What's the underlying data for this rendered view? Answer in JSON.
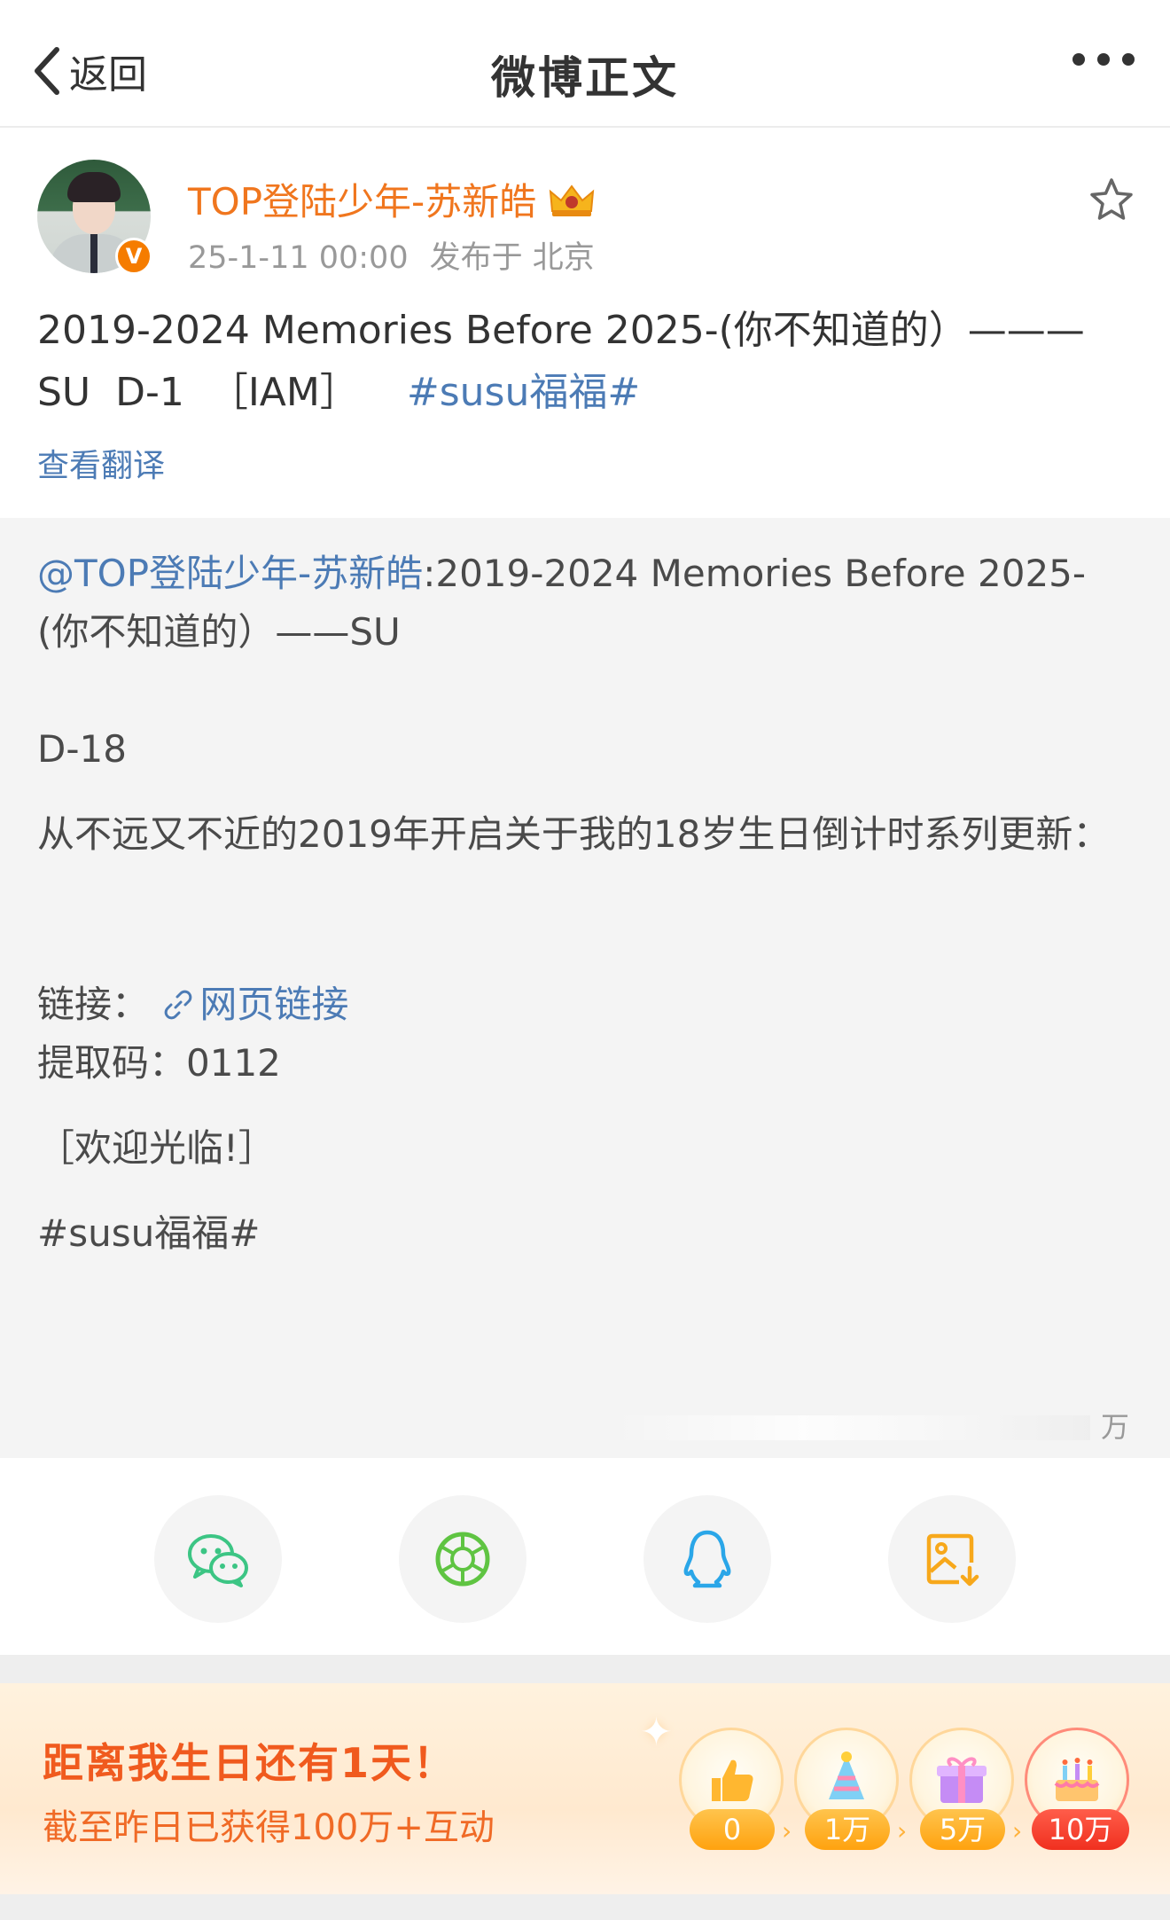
{
  "nav": {
    "back_label": "返回",
    "title": "微博正文"
  },
  "author": {
    "name": "TOP登陆少年-苏新皓",
    "verified_badge": "V",
    "timestamp": "25-1-11 00:00",
    "location": "发布于 北京"
  },
  "post": {
    "line1": "2019-2024 Memories Before 2025-(你不知道的）———",
    "line2_prefix": "SU  D-1  ［IAM］ ",
    "hashtag": "#susu福福#",
    "translate_label": "查看翻译"
  },
  "repost": {
    "mention": "@TOP登陆少年-苏新皓",
    "text_after_mention": ":2019-2024 Memories Before 2025-(你不知道的）——SU",
    "countdown": "D-18",
    "paragraph": "从不远又不近的2019年开启关于我的18岁生日倒计时系列更新：",
    "link_label": "链接：",
    "link_text": "网页链接",
    "code_label": "提取码：0112",
    "welcome": "［欢迎光临!］",
    "hashtag": "#susu福福#",
    "count_suffix": "万"
  },
  "share": {
    "icons": [
      "wechat-icon",
      "moments-icon",
      "qq-icon",
      "save-image-icon"
    ],
    "colors": {
      "wechat": "#3cc584",
      "moments": "#5fc442",
      "qq": "#2aa6e8",
      "save": "#f7a81b"
    }
  },
  "banner": {
    "title": "距离我生日还有1天！",
    "subtitle": "截至昨日已获得100万+互动",
    "milestones": [
      "0",
      "1万",
      "5万",
      "10万"
    ],
    "arrow": "›"
  },
  "colors": {
    "accent_orange": "#f0761e",
    "link_blue": "#4c7bb5",
    "banner_title": "#f05a1e"
  }
}
